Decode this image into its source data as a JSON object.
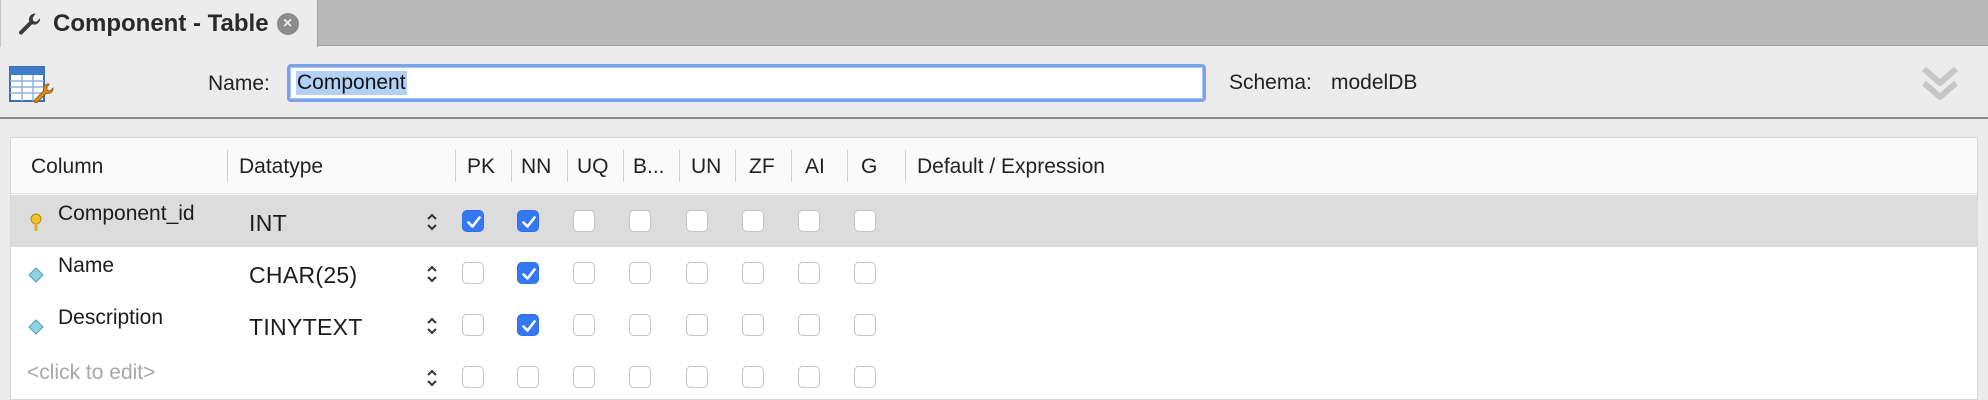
{
  "tab": {
    "title": "Component - Table",
    "close_glyph": "×",
    "icon": "wrench-icon"
  },
  "header": {
    "name_label": "Name:",
    "name_value": "Component",
    "schema_label": "Schema:",
    "schema_value": "modelDB",
    "table_icon": "table-editor-icon",
    "expand_icon": "double-chevron-down-icon"
  },
  "grid": {
    "columns": [
      "Column",
      "Datatype",
      "PK",
      "NN",
      "UQ",
      "B...",
      "UN",
      "ZF",
      "AI",
      "G",
      "Default / Expression"
    ],
    "rows": [
      {
        "name": "Component_id",
        "type": "INT",
        "icon": "primary-key-icon",
        "flags": [
          true,
          true,
          false,
          false,
          false,
          false,
          false,
          false
        ]
      },
      {
        "name": "Name",
        "type": "CHAR(25)",
        "icon": "column-diamond-icon",
        "flags": [
          false,
          true,
          false,
          false,
          false,
          false,
          false,
          false
        ]
      },
      {
        "name": "Description",
        "type": "TINYTEXT",
        "icon": "column-diamond-icon",
        "flags": [
          false,
          true,
          false,
          false,
          false,
          false,
          false,
          false
        ]
      }
    ],
    "placeholder": "<click to edit>"
  },
  "colors": {
    "accent": "#3478f6",
    "selected_row": "#dcdcdc",
    "focus_ring": "#7ca4e8"
  }
}
